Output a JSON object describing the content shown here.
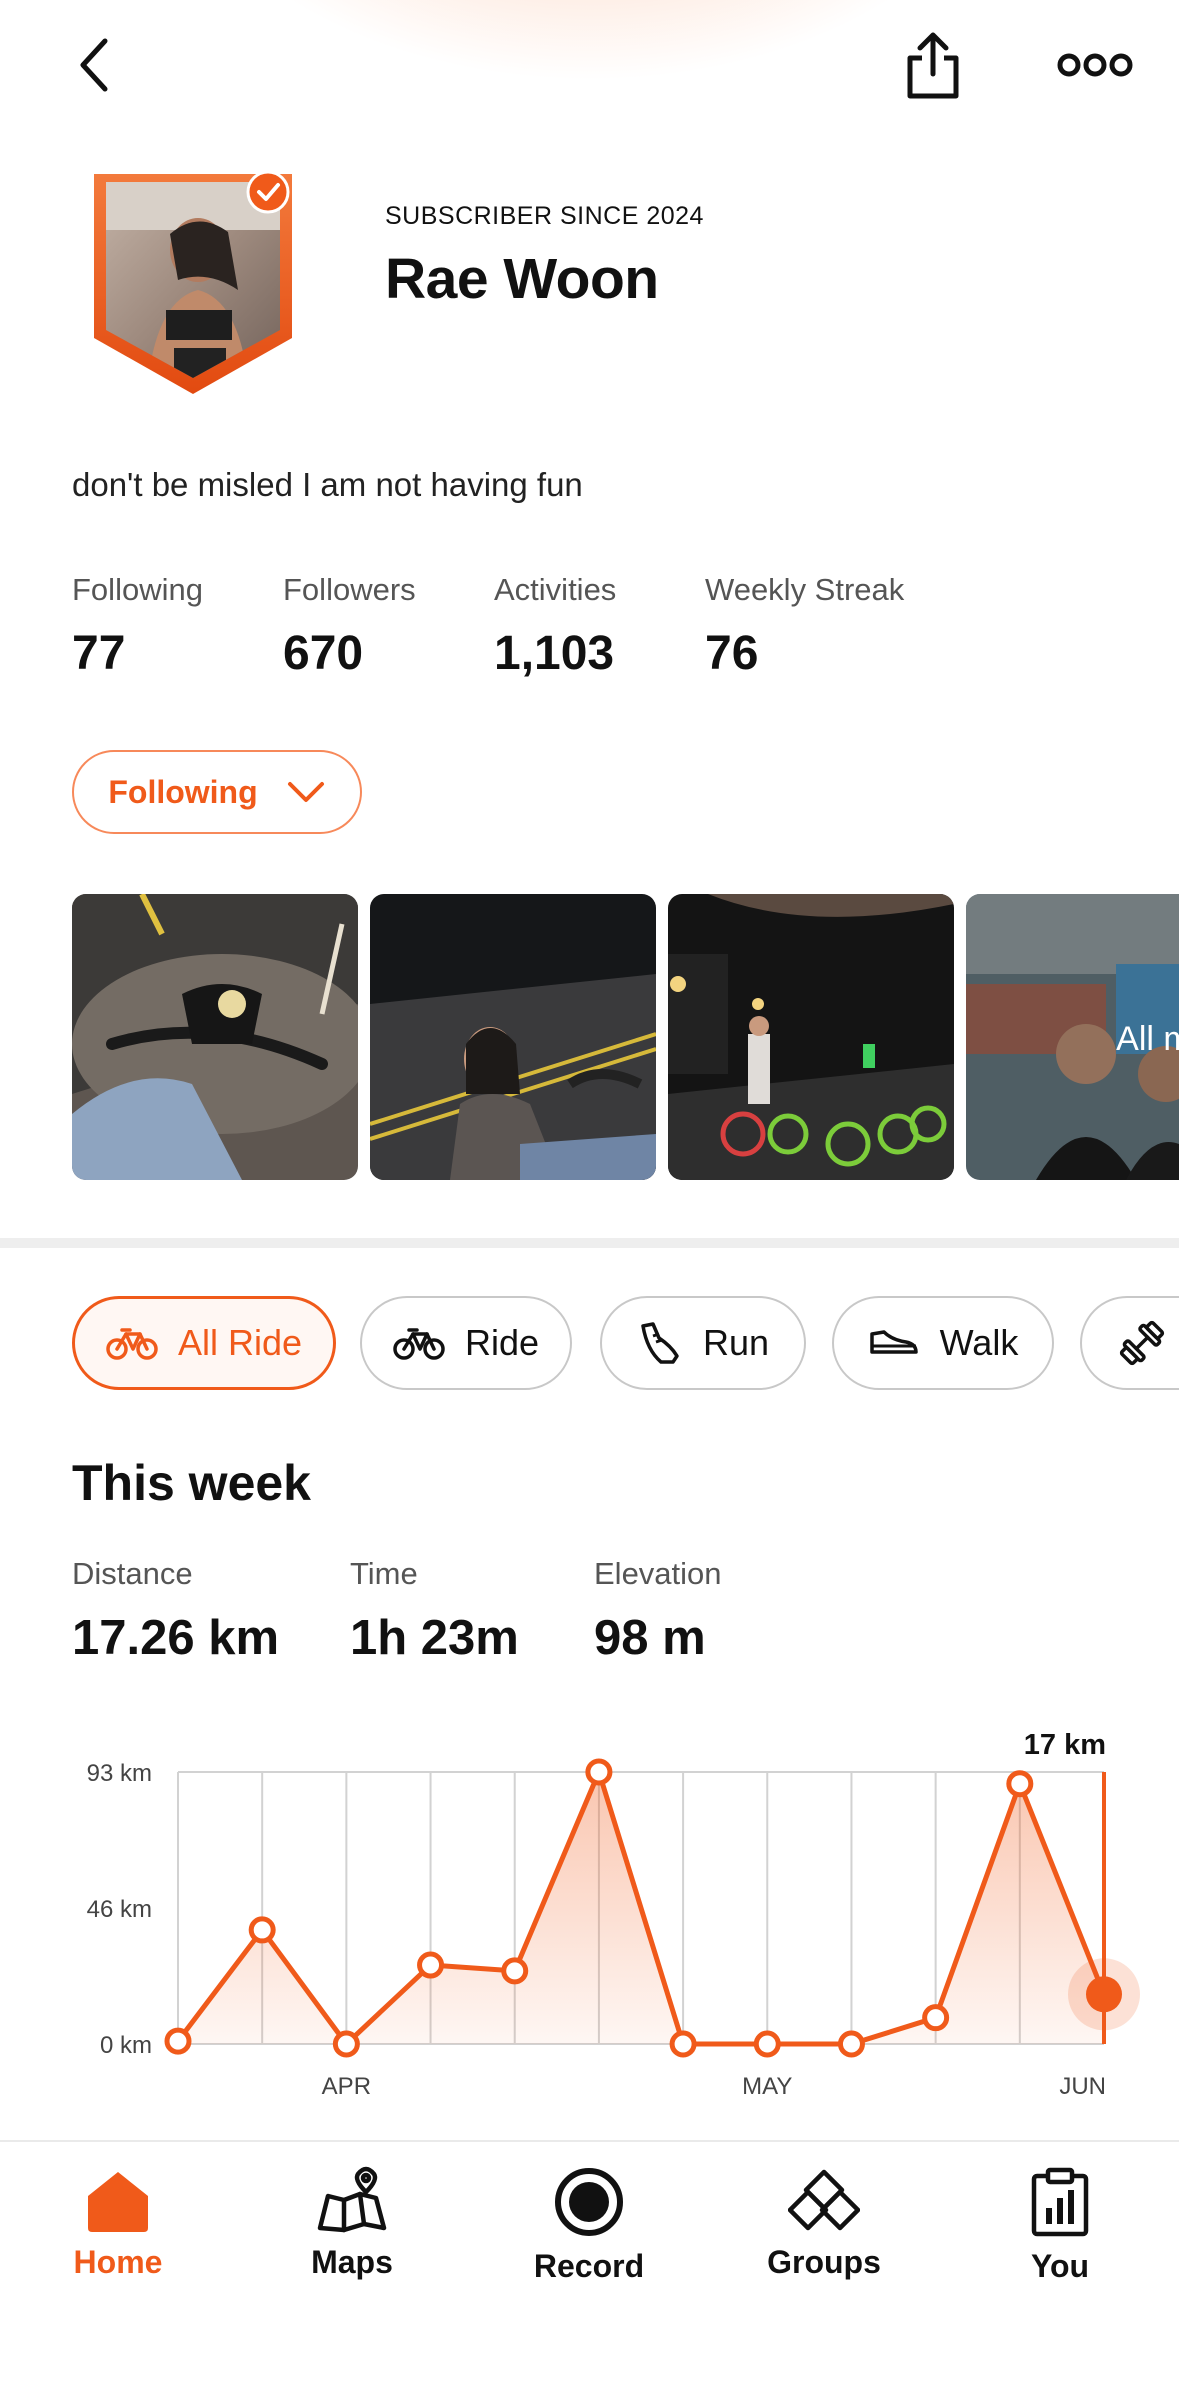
{
  "colors": {
    "accent": "#f05a1a",
    "accent_light": "#fde3d6",
    "text": "#111111",
    "muted": "#555555"
  },
  "header": {
    "back_icon": "chevron-left-icon",
    "share_icon": "share-icon",
    "more_icon": "more-dots-icon"
  },
  "profile": {
    "subscriber_label": "SUBSCRIBER SINCE 2024",
    "name": "Rae Woon",
    "bio": "don't be misled I am not having fun",
    "verified": true
  },
  "stats": [
    {
      "label": "Following",
      "value": "77"
    },
    {
      "label": "Followers",
      "value": "670"
    },
    {
      "label": "Activities",
      "value": "1,103"
    },
    {
      "label": "Weekly Streak",
      "value": "76"
    }
  ],
  "follow_button": {
    "label": "Following"
  },
  "media": {
    "all_media_label": "All media"
  },
  "filters": [
    {
      "label": "All Ride",
      "icon": "bike-icon",
      "active": true
    },
    {
      "label": "Ride",
      "icon": "bike-icon",
      "active": false
    },
    {
      "label": "Run",
      "icon": "shoe-icon",
      "active": false
    },
    {
      "label": "Walk",
      "icon": "sneaker-icon",
      "active": false
    },
    {
      "label": "",
      "icon": "dumbbell-icon",
      "active": false
    }
  ],
  "week": {
    "title": "This week",
    "stats": [
      {
        "label": "Distance",
        "value": "17.26 km"
      },
      {
        "label": "Time",
        "value": "1h 23m"
      },
      {
        "label": "Elevation",
        "value": "98 m"
      }
    ]
  },
  "chart_data": {
    "type": "area",
    "title": "",
    "ylabel": "",
    "xlabel": "",
    "ylim": [
      0,
      93
    ],
    "y_ticks": [
      "0 km",
      "46 km",
      "93 km"
    ],
    "x_tick_labels": [
      {
        "label": "APR",
        "index": 2
      },
      {
        "label": "MAY",
        "index": 7
      },
      {
        "label": "JUN",
        "index": 11
      }
    ],
    "series": [
      {
        "values": [
          1,
          39,
          0,
          27,
          25,
          93,
          0,
          0,
          0,
          9,
          89,
          17
        ]
      }
    ],
    "highlight": {
      "index": 11,
      "label": "17 km"
    },
    "grid": true
  },
  "nav": [
    {
      "label": "Home",
      "icon": "home-icon",
      "active": true
    },
    {
      "label": "Maps",
      "icon": "map-icon",
      "active": false
    },
    {
      "label": "Record",
      "icon": "record-icon",
      "active": false
    },
    {
      "label": "Groups",
      "icon": "groups-icon",
      "active": false
    },
    {
      "label": "You",
      "icon": "clipboard-chart-icon",
      "active": false
    }
  ]
}
